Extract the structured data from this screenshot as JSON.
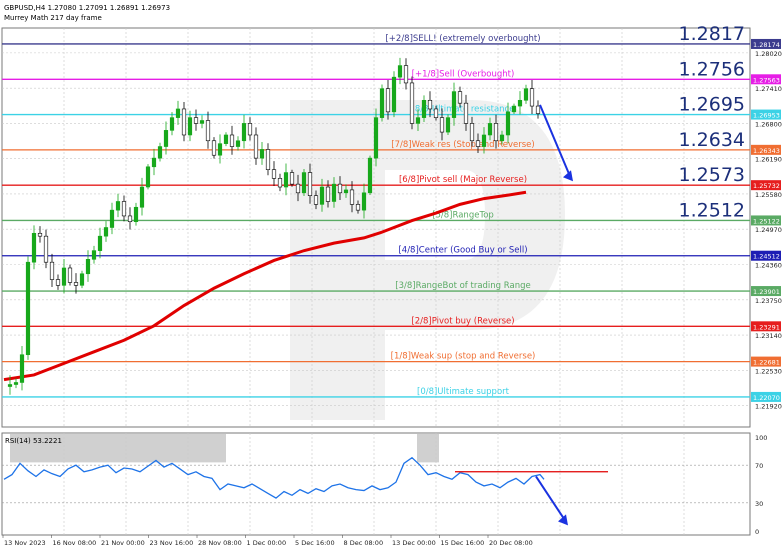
{
  "header": {
    "line1": "GBPUSD,H4  1.27080 1.27091 1.26891 1.26973",
    "line2": "Murrey Math 217 day frame"
  },
  "colors": {
    "grid": "#c9c9c9",
    "bull_candle": "#17a81b",
    "bear_candle": "#000000",
    "ma": "#e00000",
    "rsi": "#1e73e8",
    "rsi_resistance": "#e00000",
    "forecast_arrow": "#1a32e0",
    "highlight_box": "#c8c8c8",
    "watermark": "#e3e3e3"
  },
  "chart_data": {
    "type": "candlestick",
    "symbol": "GBPUSD",
    "timeframe": "H4",
    "ylim": [
      1.2155,
      1.2845
    ],
    "price_ticks": [
      "1.28020",
      "1.27410",
      "1.26800",
      "1.26190",
      "1.25580",
      "1.24970",
      "1.24360",
      "1.23750",
      "1.23140",
      "1.22530",
      "1.21920"
    ],
    "x_labels": [
      "13 Nov 2023",
      "16 Nov 08:00",
      "21 Nov 00:00",
      "23 Nov 16:00",
      "28 Nov 08:00",
      "1 Dec 00:00",
      "5 Dec 16:00",
      "8 Dec 08:00",
      "13 Dec 00:00",
      "15 Dec 16:00",
      "20 Dec 08:00"
    ],
    "price_path": [
      [
        0,
        1.2225
      ],
      [
        2,
        1.2232
      ],
      [
        3,
        1.228
      ],
      [
        4,
        1.244
      ],
      [
        5,
        1.249
      ],
      [
        6,
        1.2485
      ],
      [
        7,
        1.244
      ],
      [
        8,
        1.241
      ],
      [
        9,
        1.24
      ],
      [
        10,
        1.243
      ],
      [
        11,
        1.2405
      ],
      [
        12,
        1.24
      ],
      [
        13,
        1.242
      ],
      [
        14,
        1.2445
      ],
      [
        15,
        1.246
      ],
      [
        16,
        1.2485
      ],
      [
        17,
        1.25
      ],
      [
        18,
        1.253
      ],
      [
        19,
        1.2545
      ],
      [
        20,
        1.252
      ],
      [
        21,
        1.251
      ],
      [
        22,
        1.2535
      ],
      [
        23,
        1.257
      ],
      [
        24,
        1.2605
      ],
      [
        25,
        1.262
      ],
      [
        26,
        1.264
      ],
      [
        27,
        1.2668
      ],
      [
        28,
        1.269
      ],
      [
        29,
        1.2705
      ],
      [
        30,
        1.266
      ],
      [
        31,
        1.269
      ],
      [
        32,
        1.268
      ],
      [
        33,
        1.2685
      ],
      [
        34,
        1.265
      ],
      [
        35,
        1.2625
      ],
      [
        36,
        1.2645
      ],
      [
        37,
        1.266
      ],
      [
        38,
        1.264
      ],
      [
        39,
        1.265
      ],
      [
        40,
        1.268
      ],
      [
        41,
        1.266
      ],
      [
        42,
        1.262
      ],
      [
        43,
        1.2635
      ],
      [
        44,
        1.26
      ],
      [
        45,
        1.2585
      ],
      [
        46,
        1.257
      ],
      [
        47,
        1.2595
      ],
      [
        48,
        1.2575
      ],
      [
        49,
        1.256
      ],
      [
        50,
        1.2595
      ],
      [
        51,
        1.2555
      ],
      [
        52,
        1.254
      ],
      [
        53,
        1.257
      ],
      [
        54,
        1.2545
      ],
      [
        55,
        1.2575
      ],
      [
        56,
        1.256
      ],
      [
        57,
        1.2565
      ],
      [
        58,
        1.254
      ],
      [
        59,
        1.253
      ],
      [
        60,
        1.256
      ],
      [
        61,
        1.262
      ],
      [
        62,
        1.269
      ],
      [
        63,
        1.274
      ],
      [
        64,
        1.27
      ],
      [
        65,
        1.276
      ],
      [
        66,
        1.278
      ],
      [
        67,
        1.275
      ],
      [
        68,
        1.268
      ],
      [
        69,
        1.269
      ],
      [
        70,
        1.272
      ],
      [
        71,
        1.2705
      ],
      [
        72,
        1.269
      ],
      [
        73,
        1.2665
      ],
      [
        74,
        1.269
      ],
      [
        75,
        1.2735
      ],
      [
        76,
        1.2715
      ],
      [
        77,
        1.268
      ],
      [
        78,
        1.265
      ],
      [
        79,
        1.264
      ],
      [
        80,
        1.266
      ],
      [
        81,
        1.268
      ],
      [
        82,
        1.265
      ],
      [
        83,
        1.266
      ],
      [
        84,
        1.27
      ],
      [
        85,
        1.271
      ],
      [
        86,
        1.272
      ],
      [
        87,
        1.274
      ],
      [
        88,
        1.271
      ],
      [
        89,
        1.2697
      ]
    ],
    "ma_path": [
      [
        0,
        1.2237
      ],
      [
        5,
        1.2245
      ],
      [
        10,
        1.2265
      ],
      [
        15,
        1.2285
      ],
      [
        20,
        1.2305
      ],
      [
        25,
        1.233
      ],
      [
        30,
        1.2365
      ],
      [
        35,
        1.2395
      ],
      [
        40,
        1.242
      ],
      [
        45,
        1.2443
      ],
      [
        50,
        1.246
      ],
      [
        55,
        1.2473
      ],
      [
        60,
        1.2482
      ],
      [
        63,
        1.2492
      ],
      [
        68,
        1.2512
      ],
      [
        72,
        1.2525
      ],
      [
        76,
        1.254
      ],
      [
        80,
        1.255
      ],
      [
        84,
        1.2556
      ],
      [
        87,
        1.2561
      ]
    ],
    "murrey_levels": [
      {
        "label": "[+2/8]SELL! (extremely overbought)",
        "value": 1.28174,
        "tag": "1.28174",
        "big": "1.2817",
        "color": "#3c3c8e"
      },
      {
        "label": "[+1/8]Sell (Overbought)",
        "value": 1.27563,
        "tag": "1.27563",
        "big": "1.2756",
        "color": "#e61ee6"
      },
      {
        "label": "[8/8]Ultimate resistance",
        "value": 1.26953,
        "tag": "1.26953",
        "big": "1.2695",
        "color": "#3cd2e6"
      },
      {
        "label": "[7/8]Weak res (Stop and Reverse)",
        "value": 1.26343,
        "tag": "1.26343",
        "big": "1.2634",
        "color": "#f06e32"
      },
      {
        "label": "[6/8]Pivot sell (Major Reverse)",
        "value": 1.25732,
        "tag": "1.25732",
        "big": "1.2573",
        "color": "#e61e1e"
      },
      {
        "label": "[5/8]RangeTop",
        "value": 1.25122,
        "tag": "1.25122",
        "big": "1.2512",
        "color": "#5aaa64"
      },
      {
        "label": "[4/8]Center (Good Buy or Sell)",
        "value": 1.24512,
        "tag": "1.24512",
        "big": "",
        "color": "#1e1eb4"
      },
      {
        "label": "[3/8]RangeBot of trading Range",
        "value": 1.23901,
        "tag": "1.23901",
        "big": "",
        "color": "#5aaa64"
      },
      {
        "label": "[2/8]Pivot buy (Reverse)",
        "value": 1.23291,
        "tag": "1.23291",
        "big": "",
        "color": "#e61e1e"
      },
      {
        "label": "[1/8]Weak sup (stop and Reverse)",
        "value": 1.22681,
        "tag": "1.22681",
        "big": "",
        "color": "#f06e32"
      },
      {
        "label": "[0/8]Ultimate support",
        "value": 1.2207,
        "tag": "1.22070",
        "big": "",
        "color": "#3cd2e6"
      }
    ],
    "rsi": {
      "label": "RSI(14) 53.2221",
      "ylim": [
        0,
        100
      ],
      "ticks": [
        "100",
        "70",
        "30",
        "0"
      ],
      "resistance_level": 63,
      "path": [
        [
          0,
          55
        ],
        [
          2,
          60
        ],
        [
          4,
          72
        ],
        [
          6,
          64
        ],
        [
          8,
          58
        ],
        [
          10,
          65
        ],
        [
          12,
          61
        ],
        [
          14,
          58
        ],
        [
          16,
          66
        ],
        [
          18,
          70
        ],
        [
          20,
          63
        ],
        [
          22,
          65
        ],
        [
          24,
          68
        ],
        [
          26,
          70
        ],
        [
          28,
          62
        ],
        [
          30,
          67
        ],
        [
          32,
          66
        ],
        [
          34,
          63
        ],
        [
          36,
          69
        ],
        [
          38,
          75
        ],
        [
          40,
          68
        ],
        [
          42,
          72
        ],
        [
          44,
          66
        ],
        [
          46,
          60
        ],
        [
          48,
          63
        ],
        [
          50,
          58
        ],
        [
          52,
          56
        ],
        [
          54,
          44
        ],
        [
          56,
          50
        ],
        [
          58,
          48
        ],
        [
          60,
          46
        ],
        [
          62,
          50
        ],
        [
          64,
          45
        ],
        [
          66,
          40
        ],
        [
          68,
          35
        ],
        [
          70,
          42
        ],
        [
          72,
          38
        ],
        [
          74,
          44
        ],
        [
          76,
          40
        ],
        [
          78,
          45
        ],
        [
          80,
          42
        ],
        [
          82,
          48
        ],
        [
          84,
          50
        ],
        [
          86,
          46
        ],
        [
          88,
          44
        ],
        [
          90,
          43
        ],
        [
          92,
          48
        ],
        [
          94,
          44
        ],
        [
          96,
          46
        ],
        [
          98,
          52
        ],
        [
          100,
          72
        ],
        [
          102,
          78
        ],
        [
          104,
          70
        ],
        [
          106,
          60
        ],
        [
          108,
          62
        ],
        [
          110,
          58
        ],
        [
          112,
          55
        ],
        [
          114,
          62
        ],
        [
          116,
          60
        ],
        [
          118,
          52
        ],
        [
          120,
          48
        ],
        [
          122,
          50
        ],
        [
          124,
          46
        ],
        [
          126,
          52
        ],
        [
          128,
          56
        ],
        [
          130,
          50
        ],
        [
          132,
          58
        ],
        [
          134,
          60
        ],
        [
          135,
          55
        ]
      ]
    }
  }
}
